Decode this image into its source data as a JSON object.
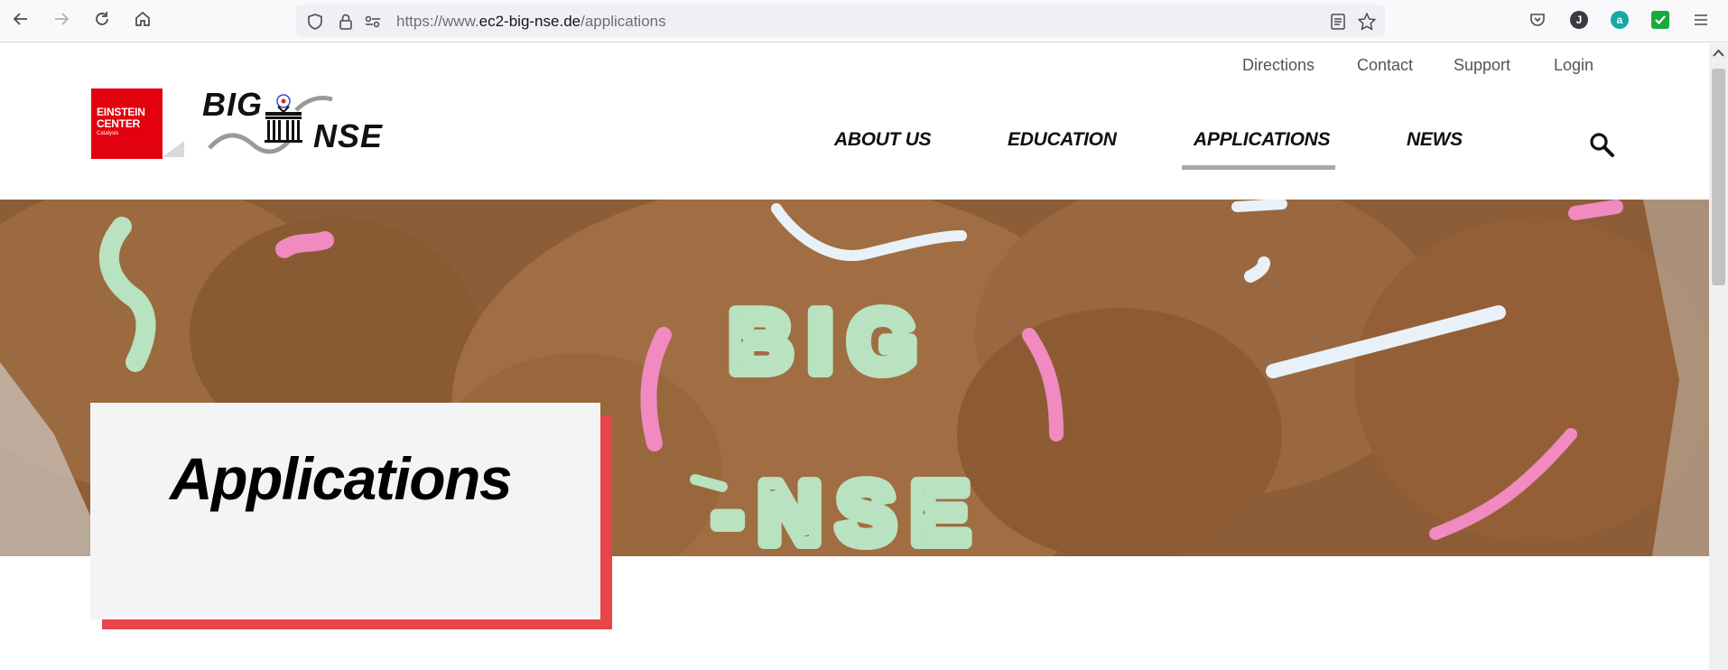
{
  "browser": {
    "url_prefix": "https://www.",
    "url_domain": "ec2-big-nse.de",
    "url_path": "/applications",
    "profile_initial": "J",
    "extension_initial": "a"
  },
  "utility_nav": {
    "items": [
      "Directions",
      "Contact",
      "Support",
      "Login"
    ]
  },
  "logo": {
    "einstein_line1": "EINSTEIN",
    "einstein_line2": "CENTER",
    "einstein_line3": "Catalysis",
    "big": "BIG",
    "nse": "NSE"
  },
  "main_nav": {
    "items": [
      "ABOUT US",
      "EDUCATION",
      "APPLICATIONS",
      "NEWS"
    ],
    "active": "APPLICATIONS"
  },
  "hero": {
    "cookie_text_line1": "BIG",
    "cookie_text_line2": "-NSE"
  },
  "page": {
    "title": "Applications"
  },
  "colors": {
    "brand_red": "#e3000f",
    "accent_red": "#e8454a",
    "nav_underline": "#a8a8a8"
  }
}
